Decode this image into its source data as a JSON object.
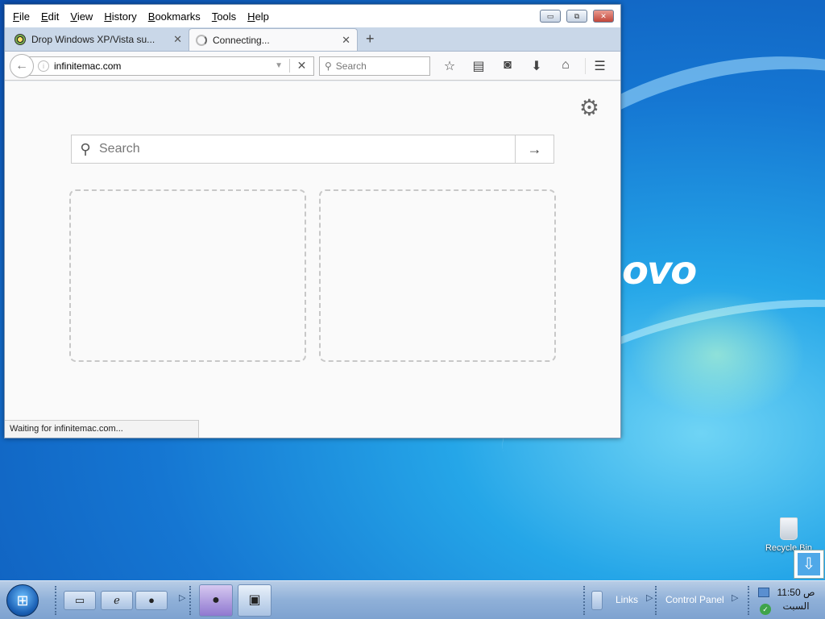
{
  "menubar": {
    "items": [
      "File",
      "Edit",
      "View",
      "History",
      "Bookmarks",
      "Tools",
      "Help"
    ]
  },
  "window_controls": {
    "minimize": "▭",
    "restore": "⧉",
    "close": "✕"
  },
  "tabs": [
    {
      "label": "Drop Windows XP/Vista su...",
      "close": "✕"
    },
    {
      "label": "Connecting...",
      "close": "✕"
    }
  ],
  "new_tab": "+",
  "navbar": {
    "back": "←",
    "url": "infinitemac.com",
    "search_placeholder": "Search",
    "stop": "✕"
  },
  "page": {
    "search_placeholder": "Search",
    "go": "→",
    "gear": "⚙"
  },
  "status_text": "Waiting for infinitemac.com...",
  "desktop": {
    "brand_text": "ovo",
    "recycle_bin_label": "Recycle Bin"
  },
  "taskbar": {
    "links_label": "Links",
    "control_panel_label": "Control Panel",
    "clock_time": "11:50 ص",
    "clock_day": "السبت"
  }
}
